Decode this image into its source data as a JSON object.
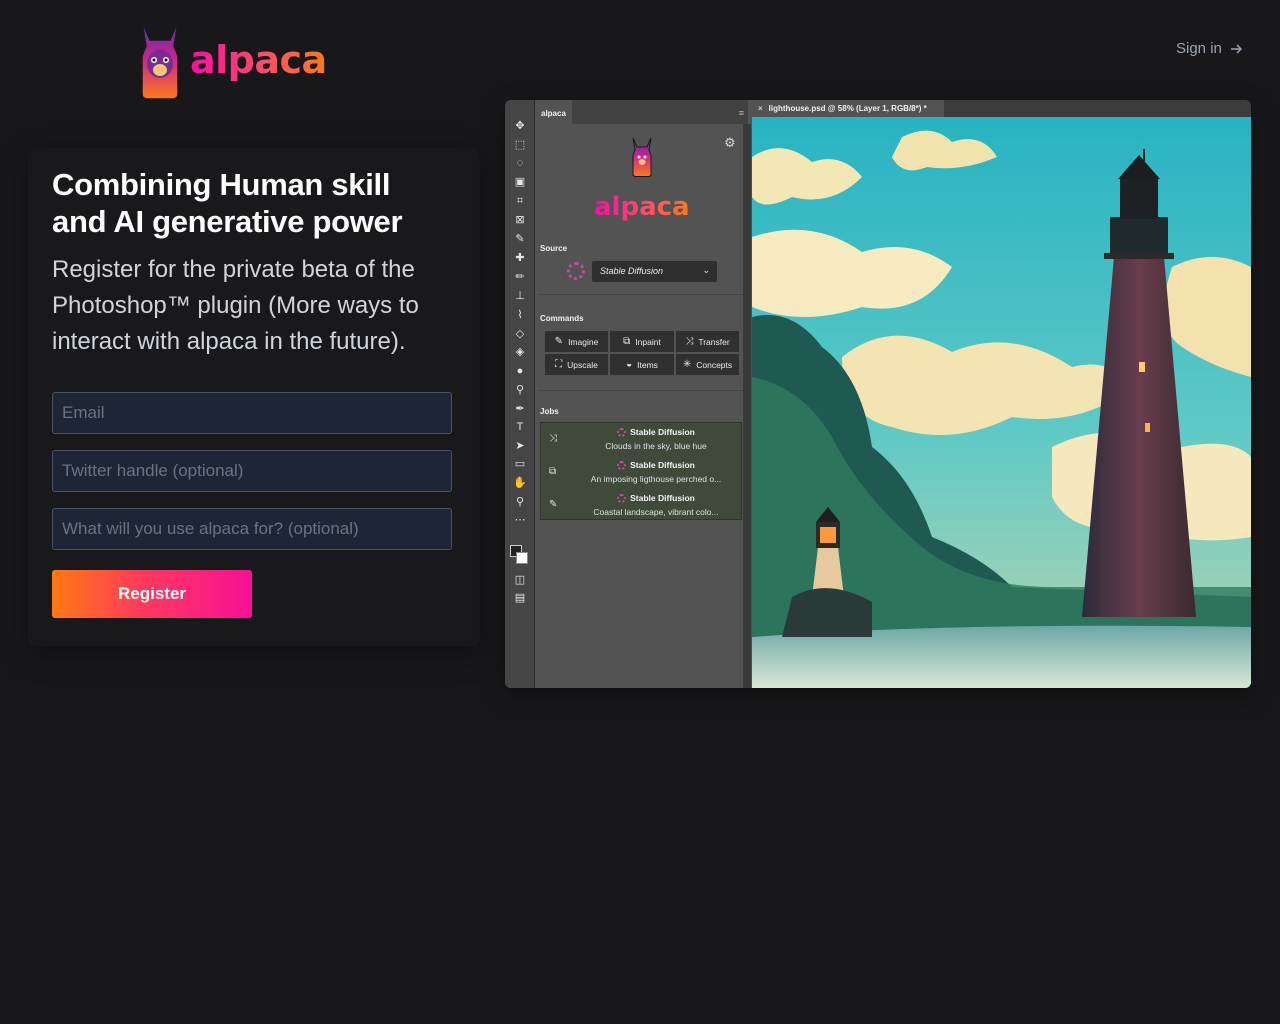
{
  "brand": {
    "name": "alpaca",
    "logo_icon": "alpaca-llama-icon"
  },
  "header": {
    "sign_in": "Sign in",
    "sign_in_icon": "arrow-right-icon"
  },
  "hero": {
    "headline": "Combining Human skill and AI generative power",
    "subtext": "Register for the private beta of the Photoshop™ plugin (More ways to interact with alpaca in the future)."
  },
  "form": {
    "email_placeholder": "Email",
    "twitter_placeholder": "Twitter handle (optional)",
    "use_placeholder": "What will you use alpaca for? (optional)",
    "register_label": "Register"
  },
  "colors": {
    "background": "#18181b",
    "brand_pink": "#f80fa0",
    "brand_orange": "#ff7a1a",
    "field_bg": "#1e2636"
  },
  "screenshot": {
    "panel_tab": "alpaca",
    "panel_brand": "alpaca",
    "document_tab": "lighthouse.psd @ 58% (Layer 1, RGB/8*) *",
    "source_label": "Source",
    "source_value": "Stable Diffusion",
    "commands_label": "Commands",
    "commands": [
      {
        "label": "Imagine",
        "icon": "pencil-icon"
      },
      {
        "label": "Inpaint",
        "icon": "layers-icon"
      },
      {
        "label": "Transfer",
        "icon": "shuffle-icon"
      },
      {
        "label": "Upscale",
        "icon": "expand-icon"
      },
      {
        "label": "Items",
        "icon": "bowl-icon"
      },
      {
        "label": "Concepts",
        "icon": "sparkle-icon"
      }
    ],
    "jobs_label": "Jobs",
    "jobs": [
      {
        "title": "Stable Diffusion",
        "desc": "Clouds in the sky, blue hue",
        "icon": "shuffle-icon"
      },
      {
        "title": "Stable Diffusion",
        "desc": "An imposing ligthouse perched o...",
        "icon": "layers-icon"
      },
      {
        "title": "Stable Diffusion",
        "desc": "Coastal landscape, vibrant colo...",
        "icon": "pencil-icon"
      }
    ]
  }
}
